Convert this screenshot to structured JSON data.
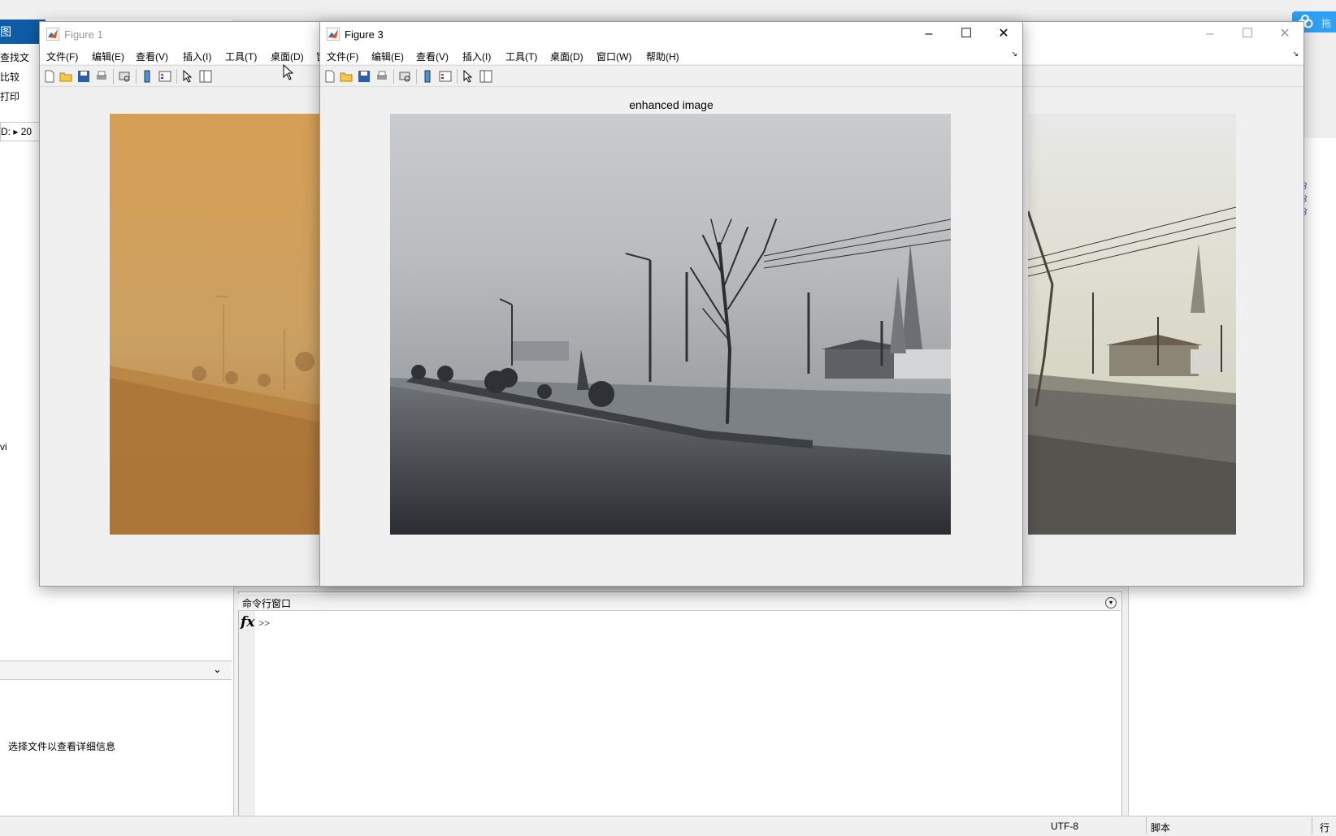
{
  "desktop": {
    "title_fragment": "图",
    "ribbon": [
      "查找文",
      "比较",
      "打印"
    ],
    "address": "D: ▸ 20",
    "details_hint": "选择文件以查看详细信息",
    "file_fragment": "vi",
    "right_values": [
      "t8",
      "t8",
      "t8"
    ],
    "command_window": {
      "title": "命令行窗口",
      "fx": "fx",
      "prompt": ">>"
    },
    "status": {
      "encoding": "UTF-8",
      "type": "脚本",
      "line": "行"
    },
    "tray_label": "拖"
  },
  "figure1": {
    "title": "Figure 1",
    "menus": [
      "文件(F)",
      "编辑(E)",
      "查看(V)",
      "插入(I)",
      "工具(T)",
      "桌面(D)",
      "窗"
    ]
  },
  "figure3": {
    "title": "Figure 3",
    "menus": [
      "文件(F)",
      "编辑(E)",
      "查看(V)",
      "插入(I)",
      "工具(T)",
      "桌面(D)",
      "窗口(W)",
      "帮助(H)"
    ],
    "axes_title": "enhanced image"
  },
  "icons": {
    "toolbar": [
      "new-figure-icon",
      "open-file-icon",
      "save-icon",
      "print-icon",
      "print-preview-icon",
      "colorbar-icon",
      "legend-icon",
      "select-pointer-icon",
      "property-inspector-icon"
    ],
    "window_controls": [
      "minimize-icon",
      "maximize-icon",
      "close-icon"
    ]
  }
}
